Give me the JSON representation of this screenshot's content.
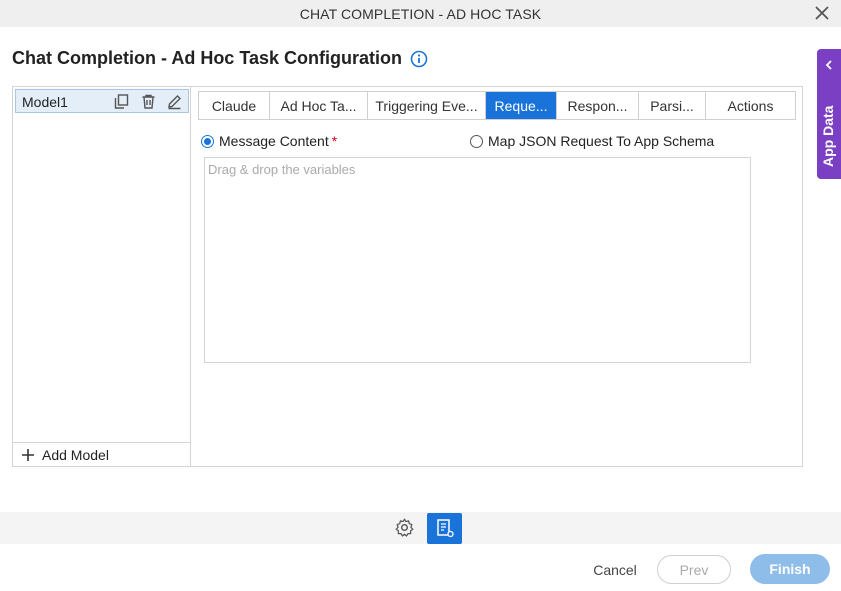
{
  "window": {
    "title": "CHAT COMPLETION - AD HOC TASK",
    "close_icon": "close-icon"
  },
  "header": {
    "title": "Chat Completion - Ad Hoc Task Configuration",
    "info_icon": "info-icon"
  },
  "side_panel": {
    "label": "App Data",
    "chevron_icon": "chevron-left-icon",
    "color": "#7b3fc4"
  },
  "models": {
    "items": [
      {
        "name": "Model1",
        "icons": [
          "copy-icon",
          "trash-icon",
          "edit-icon"
        ]
      }
    ],
    "add_label": "Add Model"
  },
  "tabs": [
    {
      "label": "Claude",
      "active": false
    },
    {
      "label": "Ad Hoc Ta...",
      "active": false
    },
    {
      "label": "Triggering Eve...",
      "active": false
    },
    {
      "label": "Reque...",
      "active": true
    },
    {
      "label": "Respon...",
      "active": false
    },
    {
      "label": "Parsi...",
      "active": false
    },
    {
      "label": "Actions",
      "active": false
    }
  ],
  "request": {
    "option_message": "Message Content",
    "required_mark": "*",
    "option_map": "Map JSON Request To App Schema",
    "selected": "message",
    "drop_placeholder": "Drag & drop the variables"
  },
  "footer": {
    "cancel_label": "Cancel",
    "prev_label": "Prev",
    "finish_label": "Finish"
  },
  "colors": {
    "accent": "#1a73d9",
    "finish": "#8fbde9"
  }
}
